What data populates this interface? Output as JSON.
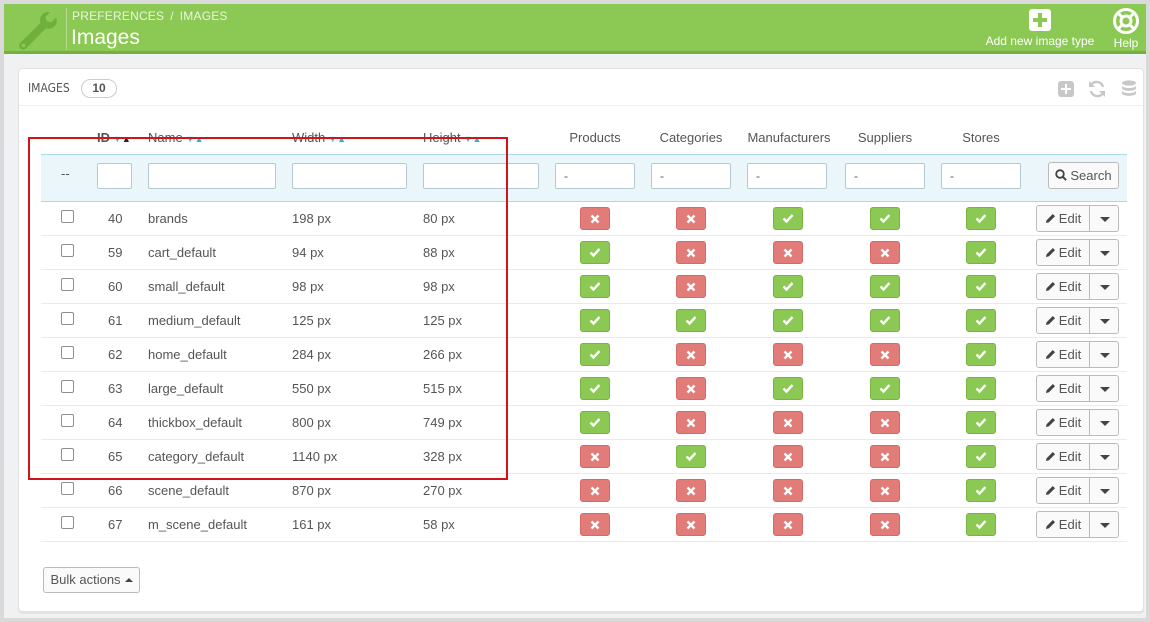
{
  "header": {
    "breadcrumb": [
      "PREFERENCES",
      "IMAGES"
    ],
    "breadcrumb_sep": "/",
    "title": "Images",
    "toolbar": {
      "add_label": "Add new image type",
      "help_label": "Help"
    },
    "logo_icon": "wrench-icon",
    "bg_color": "#8bc954"
  },
  "panel": {
    "title": "IMAGES",
    "count": "10",
    "tools": [
      "add-icon",
      "refresh-icon",
      "database-icon"
    ]
  },
  "columns": {
    "id": "ID",
    "name": "Name",
    "width": "Width",
    "height": "Height",
    "products": "Products",
    "categories": "Categories",
    "manufacturers": "Manufacturers",
    "suppliers": "Suppliers",
    "stores": "Stores"
  },
  "filters": {
    "dash": "--",
    "id": "",
    "name": "",
    "width": "",
    "height": "",
    "products": "-",
    "categories": "-",
    "manufacturers": "-",
    "suppliers": "-",
    "stores": "-",
    "search_label": "Search"
  },
  "status_colors": {
    "on": "#8bc954",
    "off": "#e27c79"
  },
  "rows": [
    {
      "id": "40",
      "name": "brands",
      "width": "198 px",
      "height": "80 px",
      "products": false,
      "categories": false,
      "manufacturers": true,
      "suppliers": true,
      "stores": true
    },
    {
      "id": "59",
      "name": "cart_default",
      "width": "94 px",
      "height": "88 px",
      "products": true,
      "categories": false,
      "manufacturers": false,
      "suppliers": false,
      "stores": true
    },
    {
      "id": "60",
      "name": "small_default",
      "width": "98 px",
      "height": "98 px",
      "products": true,
      "categories": false,
      "manufacturers": true,
      "suppliers": true,
      "stores": true
    },
    {
      "id": "61",
      "name": "medium_default",
      "width": "125 px",
      "height": "125 px",
      "products": true,
      "categories": true,
      "manufacturers": true,
      "suppliers": true,
      "stores": true
    },
    {
      "id": "62",
      "name": "home_default",
      "width": "284 px",
      "height": "266 px",
      "products": true,
      "categories": false,
      "manufacturers": false,
      "suppliers": false,
      "stores": true
    },
    {
      "id": "63",
      "name": "large_default",
      "width": "550 px",
      "height": "515 px",
      "products": true,
      "categories": false,
      "manufacturers": true,
      "suppliers": true,
      "stores": true
    },
    {
      "id": "64",
      "name": "thickbox_default",
      "width": "800 px",
      "height": "749 px",
      "products": true,
      "categories": false,
      "manufacturers": false,
      "suppliers": false,
      "stores": true
    },
    {
      "id": "65",
      "name": "category_default",
      "width": "1140 px",
      "height": "328 px",
      "products": false,
      "categories": true,
      "manufacturers": false,
      "suppliers": false,
      "stores": true
    },
    {
      "id": "66",
      "name": "scene_default",
      "width": "870 px",
      "height": "270 px",
      "products": false,
      "categories": false,
      "manufacturers": false,
      "suppliers": false,
      "stores": true
    },
    {
      "id": "67",
      "name": "m_scene_default",
      "width": "161 px",
      "height": "58 px",
      "products": false,
      "categories": false,
      "manufacturers": false,
      "suppliers": false,
      "stores": true
    }
  ],
  "row_actions": {
    "edit_label": "Edit"
  },
  "footer": {
    "bulk_label": "Bulk actions"
  }
}
